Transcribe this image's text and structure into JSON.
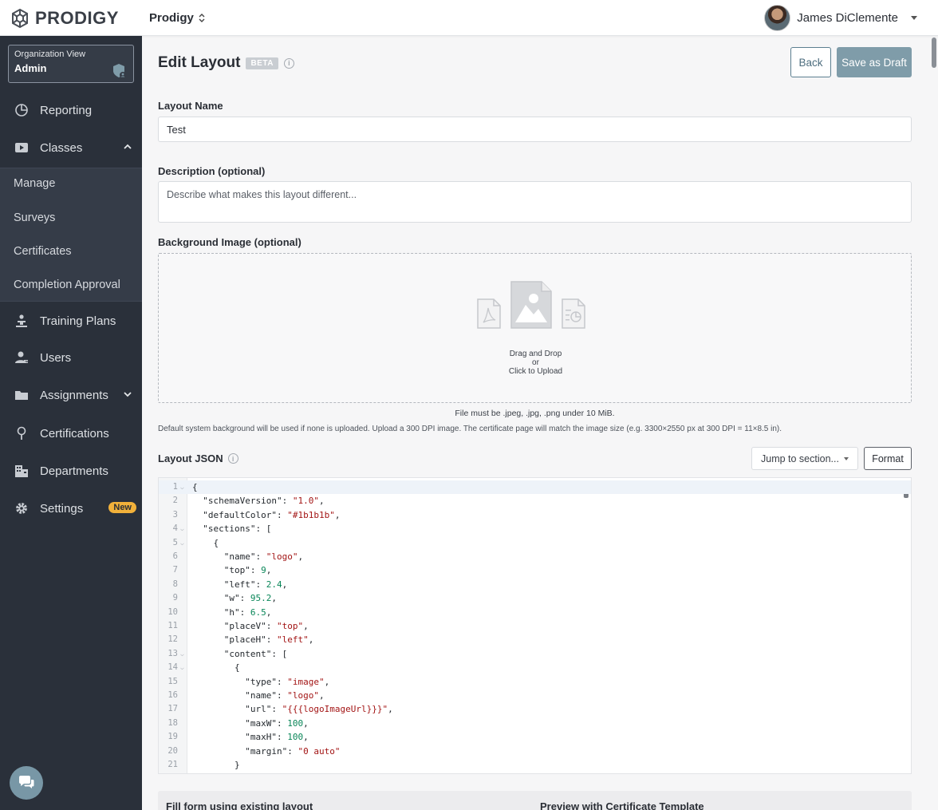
{
  "brand": {
    "name": "PRODIGY"
  },
  "org_switcher": {
    "label": "Prodigy"
  },
  "user": {
    "name": "James DiClemente"
  },
  "sidebar": {
    "org_card": {
      "title": "Organization View",
      "role": "Admin"
    },
    "items": [
      {
        "label": "Reporting"
      },
      {
        "label": "Classes"
      },
      {
        "label": "Training Plans"
      },
      {
        "label": "Users"
      },
      {
        "label": "Assignments"
      },
      {
        "label": "Certifications"
      },
      {
        "label": "Departments"
      },
      {
        "label": "Settings",
        "badge": "New"
      }
    ],
    "sub_items": [
      "Manage",
      "Surveys",
      "Certificates",
      "Completion Approval"
    ]
  },
  "header": {
    "title": "Edit Layout",
    "beta": "BETA",
    "back": "Back",
    "save_draft": "Save as Draft"
  },
  "form": {
    "name_label": "Layout Name",
    "name_value": "Test",
    "desc_label": "Description (optional)",
    "desc_placeholder": "Describe what makes this layout different...",
    "bg_label": "Background Image (optional)",
    "drop_line1": "Drag and Drop",
    "drop_line2": "or",
    "drop_line3": "Click to Upload",
    "file_hint": "File must be .jpeg, .jpg, .png under 10 MiB.",
    "bg_hint": "Default system background will be used if none is uploaded. Upload a 300 DPI image. The certificate page will match the image size (e.g. 3300×2550 px at 300 DPI = 11×8.5 in).",
    "json_label": "Layout JSON",
    "jump_label": "Jump to section...",
    "format_label": "Format"
  },
  "editor": {
    "lines": [
      "{",
      "  \"schemaVersion\": \"1.0\",",
      "  \"defaultColor\": \"#1b1b1b\",",
      "  \"sections\": [",
      "    {",
      "      \"name\": \"logo\",",
      "      \"top\": 9,",
      "      \"left\": 2.4,",
      "      \"w\": 95.2,",
      "      \"h\": 6.5,",
      "      \"placeV\": \"top\",",
      "      \"placeH\": \"left\",",
      "      \"content\": [",
      "        {",
      "          \"type\": \"image\",",
      "          \"name\": \"logo\",",
      "          \"url\": \"{{{logoImageUrl}}}\",",
      "          \"maxW\": 100,",
      "          \"maxH\": 100,",
      "          \"margin\": \"0 auto\"",
      "        }",
      "      ],"
    ],
    "fold_lines": [
      1,
      4,
      5,
      13,
      14
    ]
  },
  "bottom": {
    "fill_label": "Fill form using existing layout",
    "preview_label": "Preview with Certificate Template"
  },
  "colors": {
    "sidebar": "#2a303a",
    "accent": "#7f9ca9",
    "badge": "#f2b13a"
  }
}
